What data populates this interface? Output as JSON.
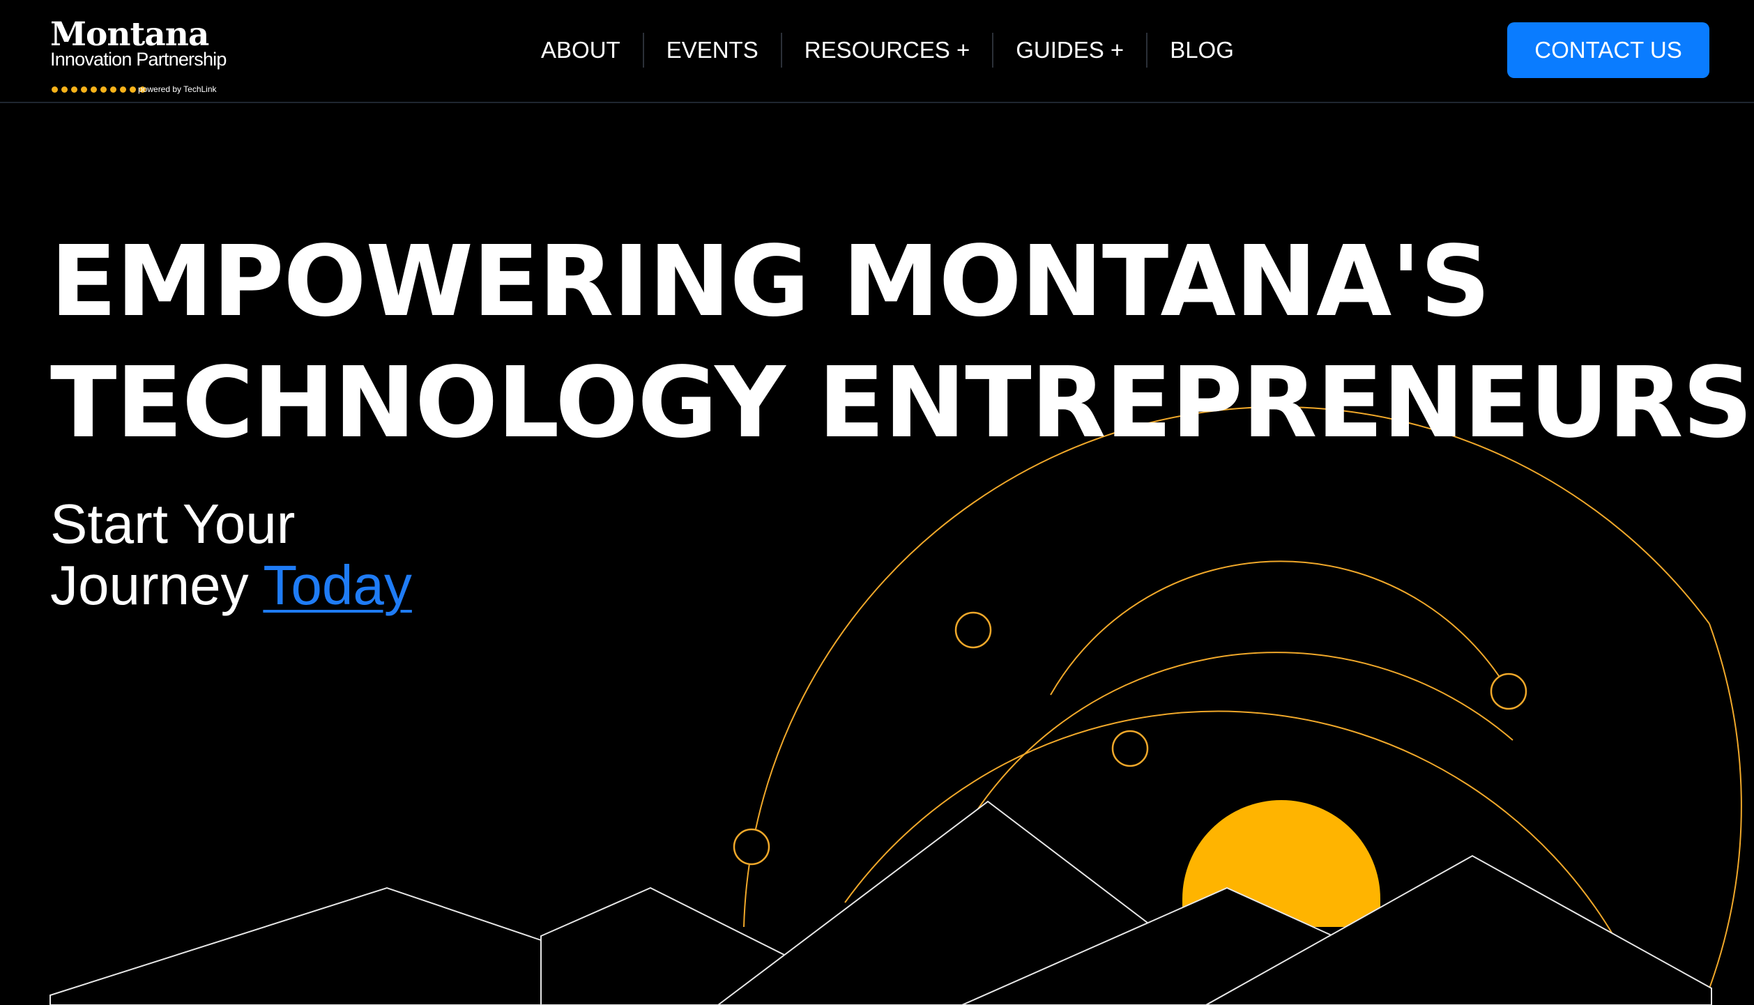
{
  "brand": {
    "title": "Montana",
    "subtitle": "Innovation Partnership",
    "powered_by": "powered by TechLink",
    "dot_color": "#f6b21b"
  },
  "nav": {
    "items": [
      {
        "label": "ABOUT"
      },
      {
        "label": "EVENTS"
      },
      {
        "label": "RESOURCES +"
      },
      {
        "label": "GUIDES +"
      },
      {
        "label": "BLOG"
      }
    ]
  },
  "header": {
    "contact_label": "CONTACT US",
    "contact_color": "#0a7cff"
  },
  "hero": {
    "headline_line1": "EMPOWERING MONTANA'S",
    "headline_line2": "TECHNOLOGY ENTREPRENEURS",
    "sub_line1": "Start Your",
    "sub_line2_prefix": "Journey ",
    "sub_link": "Today",
    "link_color": "#1f7cf6",
    "sun_color": "#ffb400",
    "orbit_color": "#f0a82a",
    "mountain_color": "#e6e6e6"
  }
}
